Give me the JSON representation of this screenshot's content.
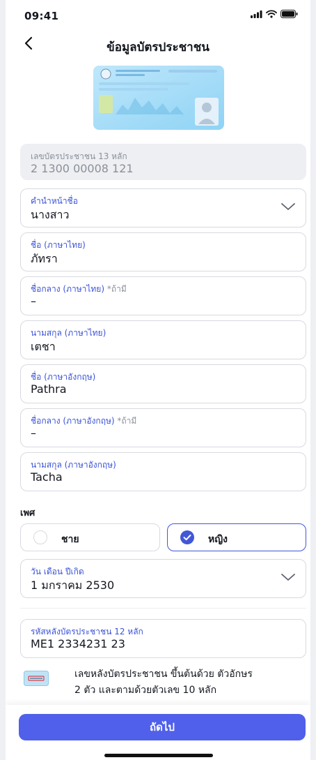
{
  "status_bar": {
    "time": "09:41"
  },
  "header": {
    "title": "ข้อมูลบัตรประชาชน"
  },
  "id_number": {
    "label": "เลขบัตรประชาชน 13 หลัก",
    "value": "2 1300 00008 121"
  },
  "title_prefix": {
    "label": "คำนำหน้าชื่อ",
    "value": "นางสาว"
  },
  "first_name_th": {
    "label": "ชื่อ (ภาษาไทย)",
    "value": "ภัทรา"
  },
  "middle_name_th": {
    "label": "ชื่อกลาง (ภาษาไทย)",
    "optional": "*ถ้ามี",
    "value": "–"
  },
  "last_name_th": {
    "label": "นามสกุล (ภาษาไทย)",
    "value": "เตชา"
  },
  "first_name_en": {
    "label": "ชื่อ (ภาษาอังกฤษ)",
    "value": "Pathra"
  },
  "middle_name_en": {
    "label": "ชื่อกลาง (ภาษาอังกฤษ)",
    "optional": "*ถ้ามี",
    "value": "–"
  },
  "last_name_en": {
    "label": "นามสกุล (ภาษาอังกฤษ)",
    "value": "Tacha"
  },
  "gender": {
    "label": "เพศ",
    "options": [
      {
        "label": "ชาย",
        "selected": false
      },
      {
        "label": "หญิง",
        "selected": true
      }
    ]
  },
  "birth_date": {
    "label": "วัน เดือน ปีเกิด",
    "value": "1 มกราคม 2530"
  },
  "laser_code": {
    "label": "รหัสหลังบัตรประชาชน 12 หลัก",
    "value": "ME1 2334231 23"
  },
  "hint": {
    "line1": "เลขหลังบัตรประชาชน ขึ้นต้นด้วย ตัวอักษร",
    "line2": "2 ตัว และตามด้วยตัวเลข 10 หลัก"
  },
  "footer": {
    "next_label": "ถัดไป"
  },
  "colors": {
    "accent": "#4257d8",
    "button": "#5060ea",
    "readonly_bg": "#eeeff2",
    "border": "#d7dae1"
  }
}
